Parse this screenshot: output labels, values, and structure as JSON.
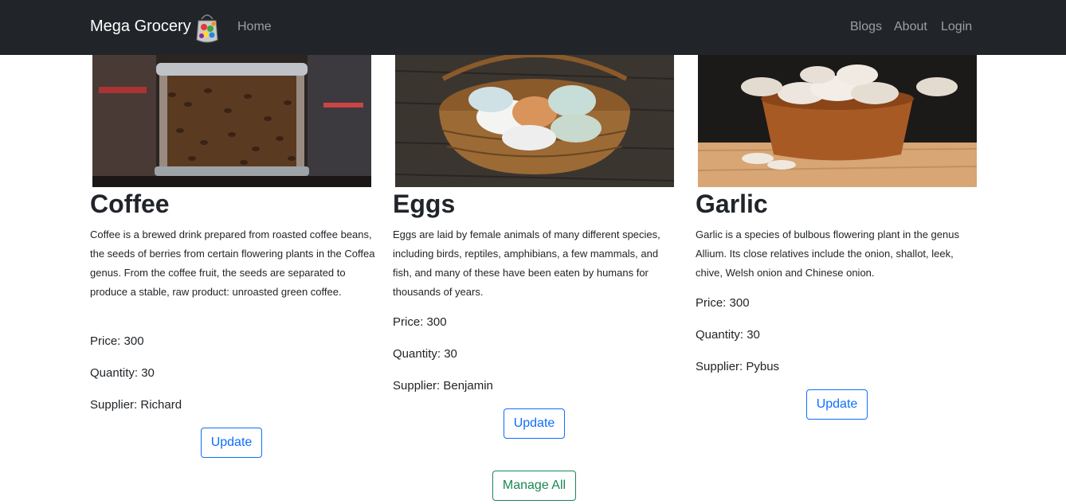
{
  "navbar": {
    "brand": "Mega Grocery",
    "links": {
      "home": "Home",
      "blogs": "Blogs",
      "about": "About",
      "login": "Login"
    }
  },
  "products": [
    {
      "name": "Coffee",
      "description": "Coffee is a brewed drink prepared from roasted coffee beans, the seeds of berries from certain flowering plants in the Coffea genus. From the coffee fruit, the seeds are separated to produce a stable, raw product: unroasted green coffee.",
      "price": "Price: 300",
      "quantity": "Quantity: 30",
      "supplier": "Supplier: Richard",
      "button": "Update"
    },
    {
      "name": "Eggs",
      "description": "Eggs are laid by female animals of many different species, including birds, reptiles, amphibians, a few mammals, and fish, and many of these have been eaten by humans for thousands of years.",
      "price": "Price: 300",
      "quantity": "Quantity: 30",
      "supplier": "Supplier: Benjamin",
      "button": "Update"
    },
    {
      "name": "Garlic",
      "description": "Garlic is a species of bulbous flowering plant in the genus Allium. Its close relatives include the onion, shallot, leek, chive, Welsh onion and Chinese onion.",
      "price": "Price: 300",
      "quantity": "Quantity: 30",
      "supplier": "Supplier: Pybus",
      "button": "Update"
    }
  ],
  "manage_all": "Manage All",
  "colors": {
    "navbar_bg": "#212529",
    "primary": "#0d6efd",
    "success": "#198754"
  }
}
